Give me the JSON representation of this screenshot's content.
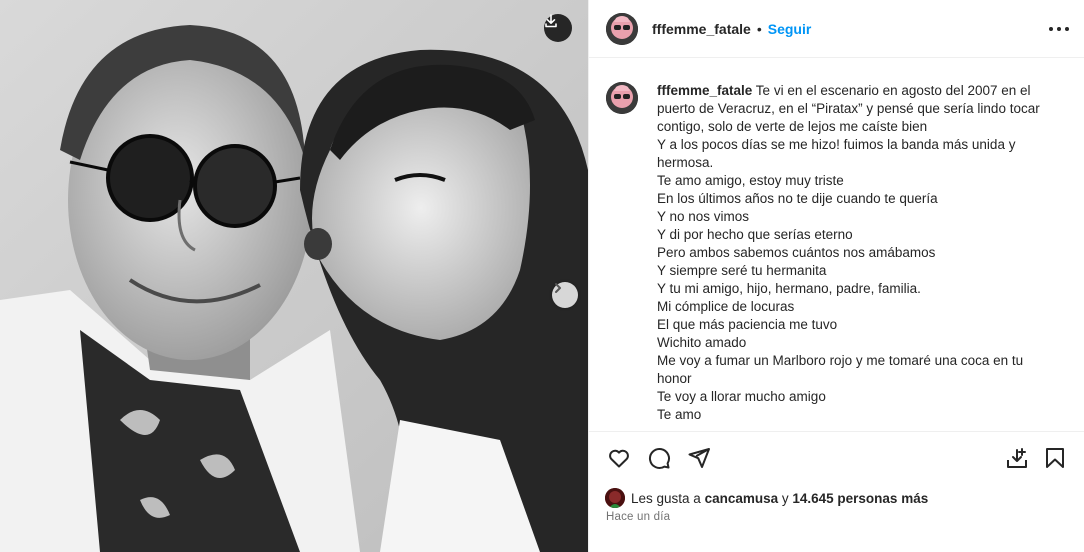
{
  "post": {
    "username": "fffemme_fatale",
    "separator": "•",
    "follow_label": "Seguir",
    "more_icon": "more-horizontal-icon"
  },
  "photo": {
    "download_icon": "download-icon",
    "next_icon": "chevron-right-icon"
  },
  "caption": {
    "username": "fffemme_fatale",
    "first_line": " Te vi en el escenario en agosto del 2007 en el puerto de Veracruz, en el “Piratax” y pensé que sería lindo tocar contigo, solo de verte de lejos me caíste bien",
    "lines": [
      "Y a los pocos días se me hizo! fuimos la banda más unida y hermosa.",
      "Te amo amigo, estoy muy triste",
      "En los últimos años no te dije cuando te quería",
      "Y no nos vimos",
      "Y di por hecho que serías eterno",
      "Pero ambos sabemos cuántos nos amábamos",
      "Y siempre seré tu hermanita",
      "Y tu mi amigo, hijo, hermano, padre, familia.",
      "Mi cómplice de locuras",
      "El que más paciencia me tuvo",
      "Wichito amado",
      "Me voy a fumar un Marlboro rojo y me tomaré una coca en tu honor",
      "Te voy a llorar mucho amigo",
      "Te amo"
    ]
  },
  "actions": {
    "like_icon": "heart-icon",
    "comment_icon": "comment-icon",
    "share_icon": "send-icon",
    "save_collection_icon": "save-to-collection-icon",
    "bookmark_icon": "bookmark-icon"
  },
  "likes": {
    "prefix": "Les gusta a ",
    "liker": "cancamusa",
    "conjunction": " y ",
    "others": "14.645 personas más"
  },
  "timestamp": "Hace un día"
}
